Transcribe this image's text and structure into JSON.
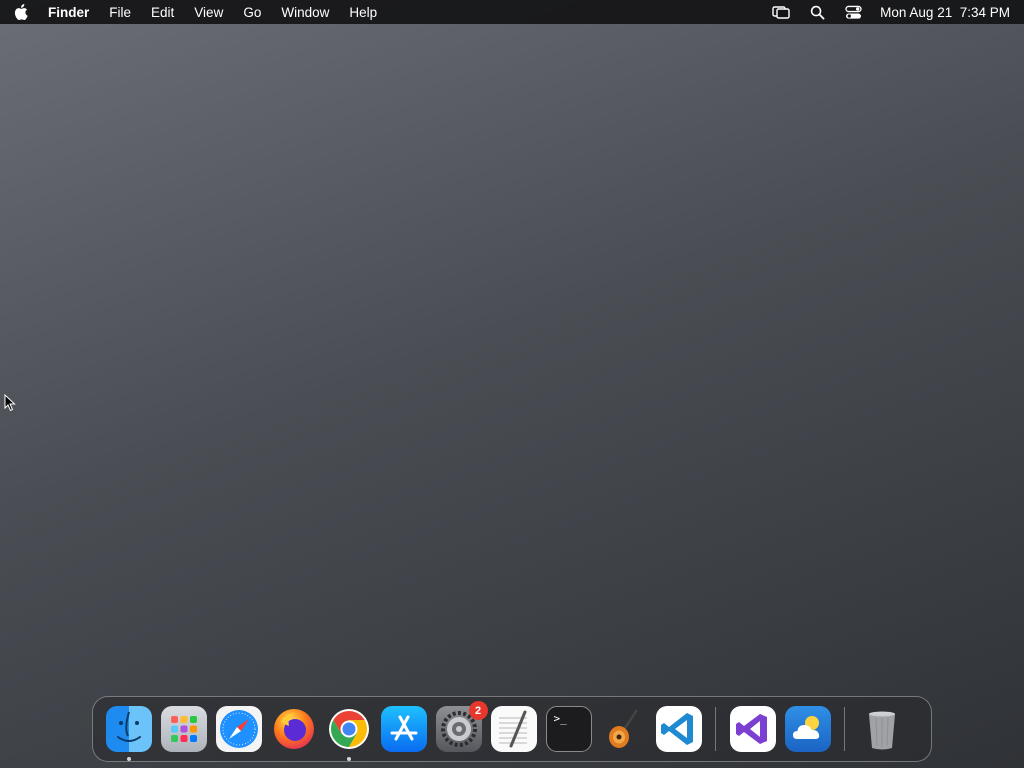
{
  "menubar": {
    "app_name": "Finder",
    "menus": [
      "File",
      "Edit",
      "View",
      "Go",
      "Window",
      "Help"
    ],
    "clock": "Mon Aug 21  7:34 PM"
  },
  "dock": {
    "system_settings_badge": "2",
    "terminal_prompt": ">_"
  }
}
